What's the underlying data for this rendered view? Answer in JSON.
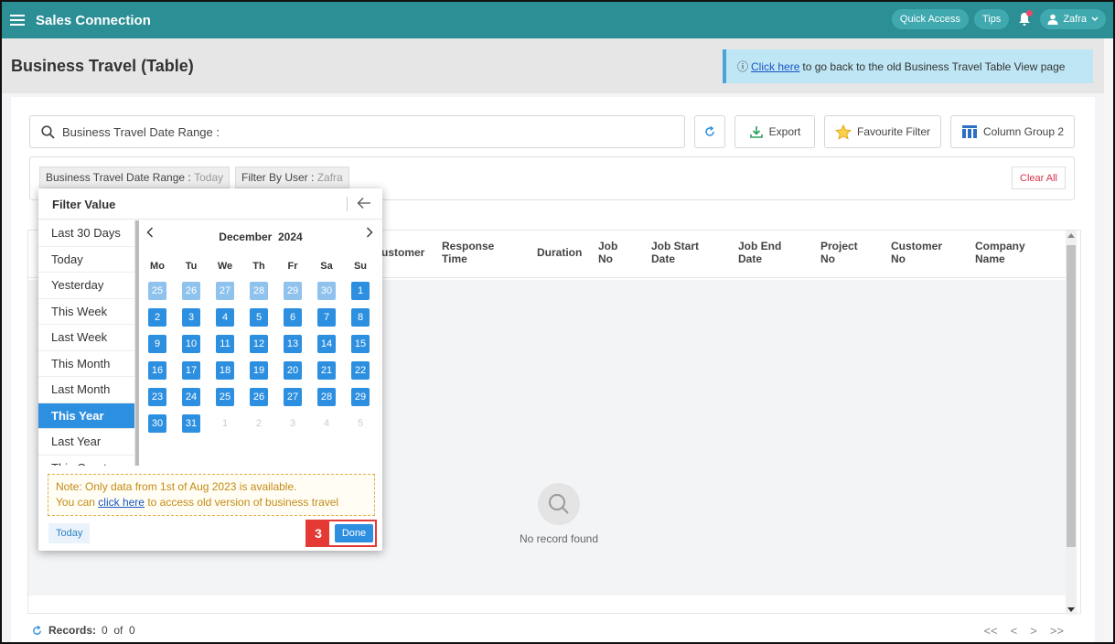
{
  "app": {
    "title": "Sales Connection",
    "quick_access": "Quick Access",
    "tips": "Tips",
    "user": "Zafra"
  },
  "page": {
    "title": "Business Travel (Table)",
    "banner_prefix": "ⓘ",
    "banner_link": "Click here",
    "banner_text": "to go back to the old Business Travel Table View page"
  },
  "toolbar": {
    "search_text": "Business Travel Date Range :",
    "export": "Export",
    "favourite_filter": "Favourite Filter",
    "column_group": "Column Group 2"
  },
  "filters": {
    "chips": [
      {
        "label": "Business Travel Date Range :",
        "value": "Today"
      },
      {
        "label": "Filter By User :",
        "value": "Zafra"
      }
    ],
    "clear_all": "Clear All"
  },
  "table": {
    "columns": [
      "ustomer",
      "Response Time",
      "Duration",
      "Job No",
      "Job Start Date",
      "Job End Date",
      "Project No",
      "Customer No",
      "Company Name"
    ],
    "empty_text": "No record found"
  },
  "footer": {
    "records_label": "Records:",
    "records_value": "0  of  0",
    "pager": [
      "<<",
      "<",
      ">",
      ">>"
    ]
  },
  "popup": {
    "title": "Filter Value",
    "ranges": [
      "Last 30 Days",
      "Today",
      "Yesterday",
      "This Week",
      "Last Week",
      "This Month",
      "Last Month",
      "This Year",
      "Last Year",
      "This Quart"
    ],
    "active_range": "This Year",
    "calendar": {
      "month": "December",
      "year": "2024",
      "weekdays": [
        "Mo",
        "Tu",
        "We",
        "Th",
        "Fr",
        "Sa",
        "Su"
      ],
      "weeks": [
        [
          [
            "25",
            "faded"
          ],
          [
            "26",
            "faded"
          ],
          [
            "27",
            "faded"
          ],
          [
            "28",
            "faded"
          ],
          [
            "29",
            "faded"
          ],
          [
            "30",
            "faded"
          ],
          [
            "1",
            "sel"
          ]
        ],
        [
          [
            "2",
            "sel"
          ],
          [
            "3",
            "sel"
          ],
          [
            "4",
            "sel"
          ],
          [
            "5",
            "sel"
          ],
          [
            "6",
            "sel"
          ],
          [
            "7",
            "sel"
          ],
          [
            "8",
            "sel"
          ]
        ],
        [
          [
            "9",
            "sel"
          ],
          [
            "10",
            "sel"
          ],
          [
            "11",
            "sel"
          ],
          [
            "12",
            "sel"
          ],
          [
            "13",
            "sel"
          ],
          [
            "14",
            "sel"
          ],
          [
            "15",
            "sel"
          ]
        ],
        [
          [
            "16",
            "sel"
          ],
          [
            "17",
            "sel"
          ],
          [
            "18",
            "sel"
          ],
          [
            "19",
            "sel"
          ],
          [
            "20",
            "sel"
          ],
          [
            "21",
            "sel"
          ],
          [
            "22",
            "sel"
          ]
        ],
        [
          [
            "23",
            "sel"
          ],
          [
            "24",
            "sel"
          ],
          [
            "25",
            "sel"
          ],
          [
            "26",
            "sel"
          ],
          [
            "27",
            "sel"
          ],
          [
            "28",
            "sel"
          ],
          [
            "29",
            "sel"
          ]
        ],
        [
          [
            "30",
            "sel"
          ],
          [
            "31",
            "sel"
          ],
          [
            "1",
            "off"
          ],
          [
            "2",
            "off"
          ],
          [
            "3",
            "off"
          ],
          [
            "4",
            "off"
          ],
          [
            "5",
            "off"
          ]
        ]
      ]
    },
    "note_line1": "Note: Only data from 1st of Aug 2023 is available.",
    "note_line2_prefix": "You can",
    "note_link": "click here",
    "note_line2_suffix": "to access old version of business travel",
    "today_button": "Today",
    "done_button": "Done",
    "step_badge": "3"
  },
  "colors": {
    "topbar": "#2c8f96",
    "accent_blue": "#2d8fe0",
    "highlight_red": "#e53935"
  }
}
